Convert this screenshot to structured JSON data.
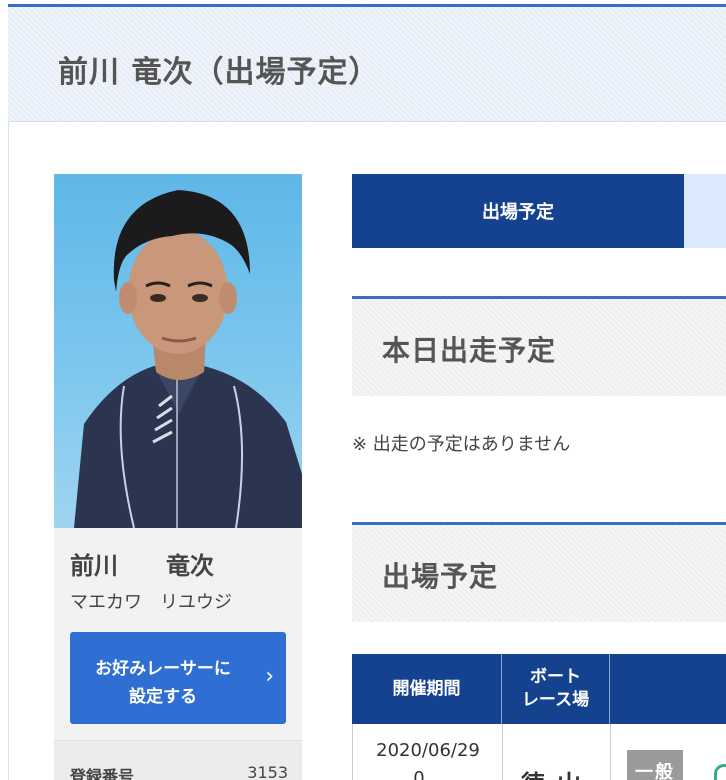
{
  "header": {
    "title": "前川 竜次（出場予定）"
  },
  "profile": {
    "name_kanji": "前川　　竜次",
    "name_kana": "マエカワ　リユウジ",
    "favorite_button": {
      "line1": "お好みレーサーに",
      "line2": "設定する",
      "icon": "chevron-right-icon"
    },
    "registration": {
      "label": "登録番号",
      "value": "3153"
    }
  },
  "tabs": [
    {
      "label": "出場予定",
      "active": true
    },
    {
      "label": "",
      "active": false
    }
  ],
  "today": {
    "heading": "本日出走予定",
    "note": "※ 出走の予定はありません"
  },
  "upcoming": {
    "heading": "出場予定",
    "columns": [
      "開催期間",
      "ボート\nレース場",
      ""
    ],
    "rows": [
      {
        "period_start": "2020/06/29",
        "period_end": "0…",
        "venue": "徳山",
        "grade": "一般"
      }
    ]
  },
  "colors": {
    "accent": "#3a6fc4",
    "tab_active": "#15428f",
    "button": "#2f6fd3",
    "grade_badge": "#9a9a9a"
  }
}
